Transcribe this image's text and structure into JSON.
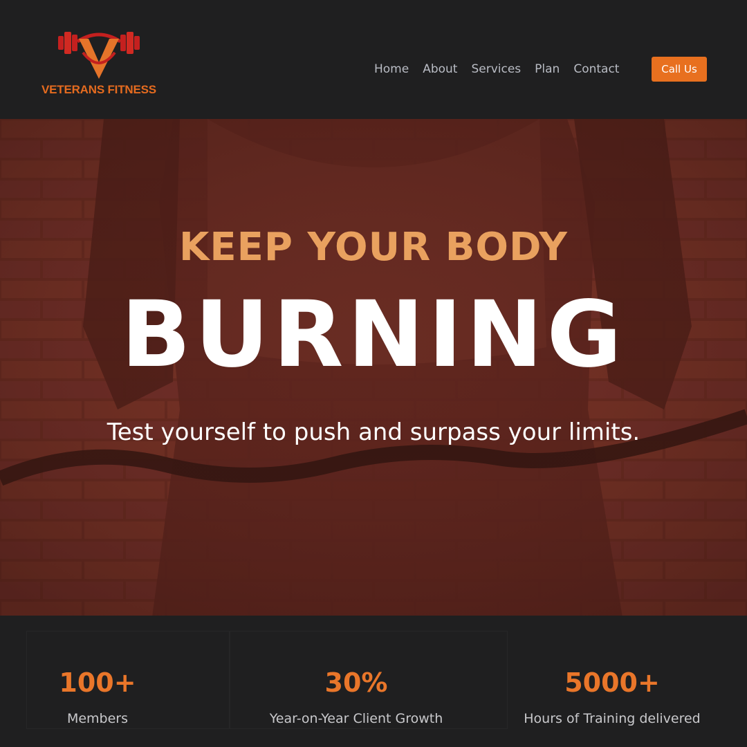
{
  "brand": {
    "name": "VETERANS FITNESS",
    "logo_icon": "barbell-v-icon",
    "color": "#e56b1f"
  },
  "nav": {
    "items": [
      "Home",
      "About",
      "Services",
      "Plan",
      "Contact"
    ],
    "cta_label": "Call Us",
    "cta_color": "#e8701f"
  },
  "hero": {
    "kicker": "KEEP YOUR BODY",
    "title": "BURNING",
    "subtitle": "Test yourself to push and surpass your limits.",
    "kicker_color": "#e9a15f",
    "overlay_color": "#6e2e22"
  },
  "stats": [
    {
      "value": "100+",
      "label": "Members"
    },
    {
      "value": "30%",
      "label": "Year-on-Year Client Growth"
    },
    {
      "value": "5000+",
      "label": "Hours of Training delivered"
    }
  ],
  "colors": {
    "background": "#1f1f20",
    "accent": "#e9762a"
  }
}
